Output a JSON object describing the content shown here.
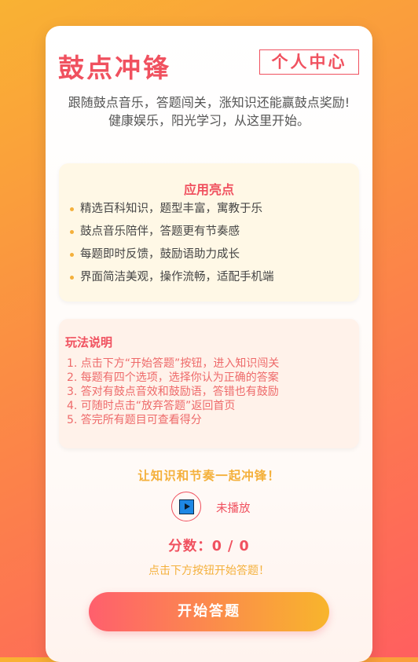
{
  "header": {
    "title": "鼓点冲锋",
    "profile_button": "个人中心"
  },
  "intro": {
    "line1": "跟随鼓点音乐，答题闯关，涨知识还能赢鼓点奖励!",
    "line2": "健康娱乐，阳光学习，从这里开始。"
  },
  "highlights": {
    "title": "应用亮点",
    "items": [
      "精选百科知识，题型丰富，寓教于乐",
      "鼓点音乐陪伴，答题更有节奏感",
      "每题即时反馈，鼓励语助力成长",
      "界面简洁美观，操作流畅，适配手机端"
    ]
  },
  "rules": {
    "title": "玩法说明",
    "items": [
      "1. 点击下方“开始答题”按钮，进入知识闯关",
      "2. 每题有四个选项，选择你认为正确的答案",
      "3. 答对有鼓点音效和鼓励语，答错也有鼓励",
      "4. 可随时点击“放弃答题”返回首页",
      "5. 答完所有题目可查看得分"
    ]
  },
  "footer": {
    "slogan": "让知识和节奏一起冲锋！",
    "audio_status": "未播放",
    "score": "分数：0 / 0",
    "hint": "点击下方按钮开始答题！",
    "start_button": "开始答题",
    "play_icon": "play-icon"
  },
  "colors": {
    "accent": "#f0515f",
    "secondary": "#f4b03b",
    "highlight_bg": "#fff8e6",
    "rules_bg": "#fff2ea"
  }
}
